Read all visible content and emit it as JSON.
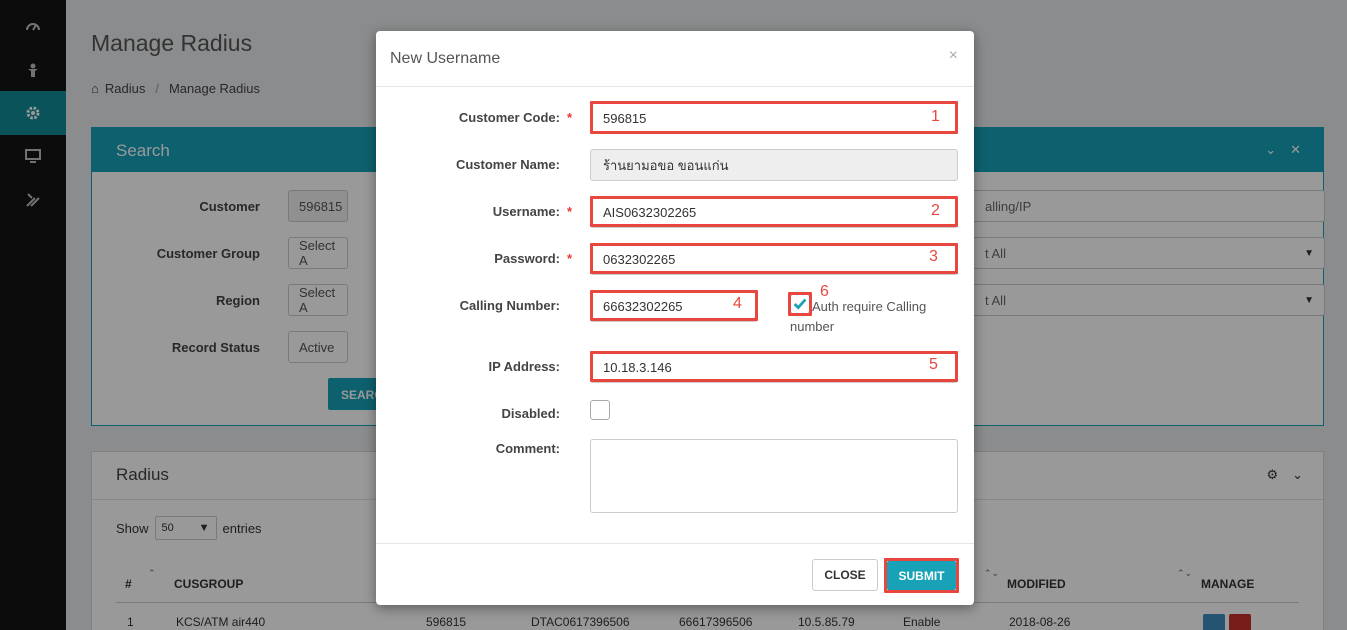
{
  "page": {
    "title": "Manage Radius"
  },
  "breadcrumb": {
    "home": "Radius",
    "current": "Manage Radius"
  },
  "search": {
    "title": "Search",
    "customer_label": "Customer",
    "customer_value": "596815",
    "group_label": "Customer Group",
    "group_value": "Select A",
    "region_label": "Region",
    "region_value": "Select A",
    "status_label": "Record Status",
    "status_value": "Active",
    "button": "SEARC",
    "right_input": "alling/IP",
    "right_sel1": "t All",
    "right_sel2": "t All"
  },
  "radius": {
    "title": "Radius",
    "show": "Show",
    "show_value": "50",
    "entries": "entries",
    "headers": {
      "num": "#",
      "cusgroup": "CUSGROUP",
      "modified": "MODIFIED",
      "manage": "MANAGE"
    },
    "row": {
      "idx": "1",
      "cusgroup": "KCS/ATM air440",
      "code": "596815",
      "username": "DTAC0617396506",
      "calling": "66617396506",
      "ip": "10.5.85.79",
      "status": "Enable",
      "modified": "2018-08-26"
    }
  },
  "modal": {
    "title": "New Username",
    "close_x": "×",
    "customer_code_label": "Customer Code:",
    "customer_code_value": "596815",
    "customer_name_label": "Customer Name:",
    "customer_name_value": "ร้านยามอขอ ขอนแก่น",
    "username_label": "Username:",
    "username_value": "AIS0632302265",
    "password_label": "Password:",
    "password_value": "0632302265",
    "calling_label": "Calling Number:",
    "calling_value": "66632302265",
    "auth_label": "Auth require Calling number",
    "ip_label": "IP Address:",
    "ip_value": "10.18.3.146",
    "disabled_label": "Disabled:",
    "comment_label": "Comment:",
    "required": "*",
    "close_button": "CLOSE",
    "submit_button": "SUBMIT"
  },
  "annotations": {
    "n1": "1",
    "n2": "2",
    "n3": "3",
    "n4": "4",
    "n5": "5",
    "n6": "6"
  },
  "colors": {
    "accent": "#17a2b8",
    "highlight": "#e8473f",
    "sidebar": "#141414"
  }
}
